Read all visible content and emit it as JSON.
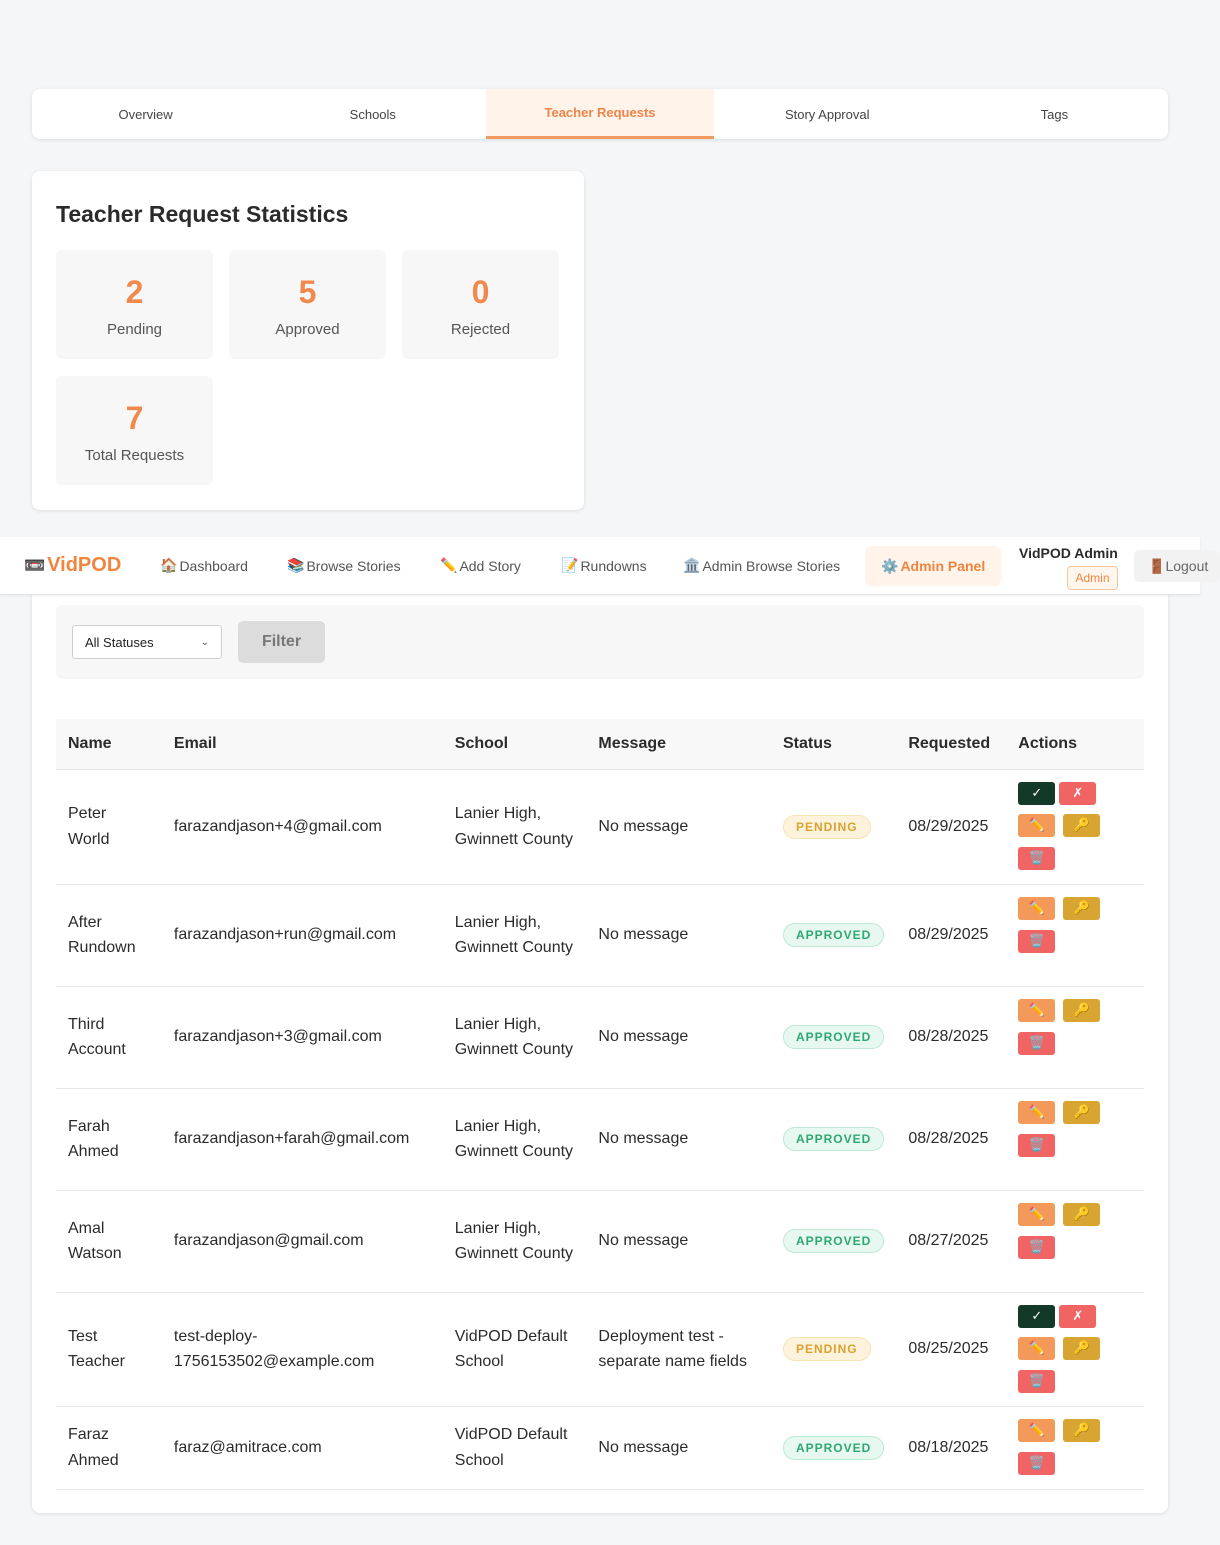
{
  "tabs": [
    "Overview",
    "Schools",
    "Teacher Requests",
    "Story Approval",
    "Tags"
  ],
  "stats": {
    "title": "Teacher Request Statistics",
    "pending": {
      "value": "2",
      "label": "Pending"
    },
    "approved": {
      "value": "5",
      "label": "Approved"
    },
    "rejected": {
      "value": "0",
      "label": "Rejected"
    },
    "total": {
      "value": "7",
      "label": "Total Requests"
    }
  },
  "navbar": {
    "brand": "VidPOD",
    "brand_icon": "tv-icon",
    "items": [
      {
        "label": "Dashboard",
        "icon": "🏠"
      },
      {
        "label": "Browse Stories",
        "icon": "📚"
      },
      {
        "label": "Add Story",
        "icon": "✏️"
      },
      {
        "label": "Rundowns",
        "icon": "📝"
      },
      {
        "label": "Admin Browse Stories",
        "icon": "🏛️"
      }
    ],
    "active": {
      "label": "Admin Panel",
      "icon": "⚙️"
    },
    "user": "VidPOD Admin",
    "role": "Admin",
    "logout": {
      "label": "Logout",
      "icon": "🚪"
    }
  },
  "filter": {
    "selected": "All Statuses",
    "button": "Filter"
  },
  "table": {
    "headers": [
      "Name",
      "Email",
      "School",
      "Message",
      "Status",
      "Requested",
      "Actions"
    ],
    "rows": [
      {
        "name": "Peter World",
        "email": "farazandjason+4@gmail.com",
        "school": "Lanier High, Gwinnett County",
        "message": "No message",
        "status": "PENDING",
        "requested": "08/29/2025"
      },
      {
        "name": "After Rundown",
        "email": "farazandjason+run@gmail.com",
        "school": "Lanier High, Gwinnett County",
        "message": "No message",
        "status": "APPROVED",
        "requested": "08/29/2025"
      },
      {
        "name": "Third Account",
        "email": "farazandjason+3@gmail.com",
        "school": "Lanier High, Gwinnett County",
        "message": "No message",
        "status": "APPROVED",
        "requested": "08/28/2025"
      },
      {
        "name": "Farah Ahmed",
        "email": "farazandjason+farah@gmail.com",
        "school": "Lanier High, Gwinnett County",
        "message": "No message",
        "status": "APPROVED",
        "requested": "08/28/2025"
      },
      {
        "name": "Amal Watson",
        "email": "farazandjason@gmail.com",
        "school": "Lanier High, Gwinnett County",
        "message": "No message",
        "status": "APPROVED",
        "requested": "08/27/2025"
      },
      {
        "name": "Test Teacher",
        "email": "test-deploy-1756153502@example.com",
        "school": "VidPOD Default School",
        "message": "Deployment test - separate name fields",
        "status": "PENDING",
        "requested": "08/25/2025"
      },
      {
        "name": "Faraz Ahmed",
        "email": "faraz@amitrace.com",
        "school": "VidPOD Default School",
        "message": "No message",
        "status": "APPROVED",
        "requested": "08/18/2025"
      }
    ]
  },
  "action_icons": {
    "approve": "✓",
    "reject": "✗",
    "edit": "✏️",
    "key": "🔑",
    "delete": "🗑️"
  }
}
